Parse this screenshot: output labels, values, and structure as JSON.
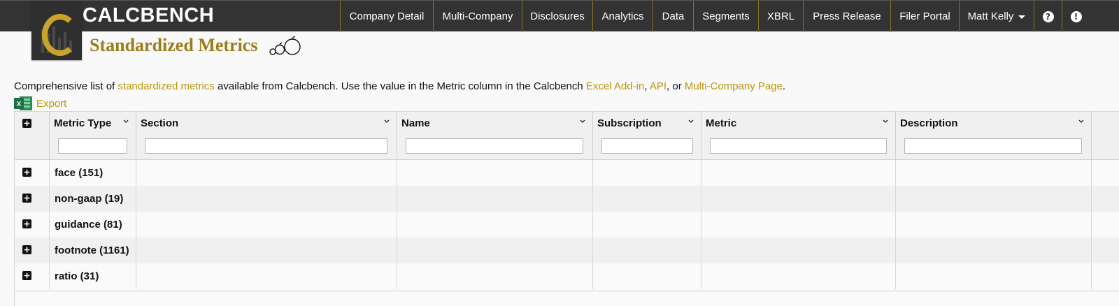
{
  "app": {
    "brand": "CALCBENCH",
    "page_title": "Standardized Metrics"
  },
  "nav": {
    "items": [
      {
        "label": "Company Detail"
      },
      {
        "label": "Multi-Company"
      },
      {
        "label": "Disclosures"
      },
      {
        "label": "Analytics"
      },
      {
        "label": "Data"
      },
      {
        "label": "Segments"
      },
      {
        "label": "XBRL"
      },
      {
        "label": "Press Release"
      },
      {
        "label": "Filer Portal"
      }
    ],
    "user": "Matt Kelly",
    "help_icon": "?",
    "alert_icon": "!"
  },
  "intro": {
    "p1": "Comprehensive list of ",
    "link1": "standardized metrics",
    "p2": " available from Calcbench. Use the value in the Metric column in the Calcbench ",
    "link2": "Excel Add-in",
    "p3": ", ",
    "link3": "API",
    "p4": ", or ",
    "link4": "Multi-Company Page",
    "p5": "."
  },
  "export": {
    "label": "Export",
    "icon_letter": "X"
  },
  "table": {
    "columns": [
      {
        "label": "Metric Type",
        "filter": ""
      },
      {
        "label": "Section",
        "filter": ""
      },
      {
        "label": "Name",
        "filter": ""
      },
      {
        "label": "Subscription",
        "filter": ""
      },
      {
        "label": "Metric",
        "filter": ""
      },
      {
        "label": "Description",
        "filter": ""
      }
    ],
    "groups": [
      {
        "label": "face (151)"
      },
      {
        "label": "non-gaap (19)"
      },
      {
        "label": "guidance (81)"
      },
      {
        "label": "footnote (1161)"
      },
      {
        "label": "ratio (31)"
      }
    ]
  },
  "colors": {
    "topbar": "#333333",
    "accent_gold": "#b8960e",
    "title_gold": "#9c7d1d",
    "excel_green": "#1d7044"
  }
}
